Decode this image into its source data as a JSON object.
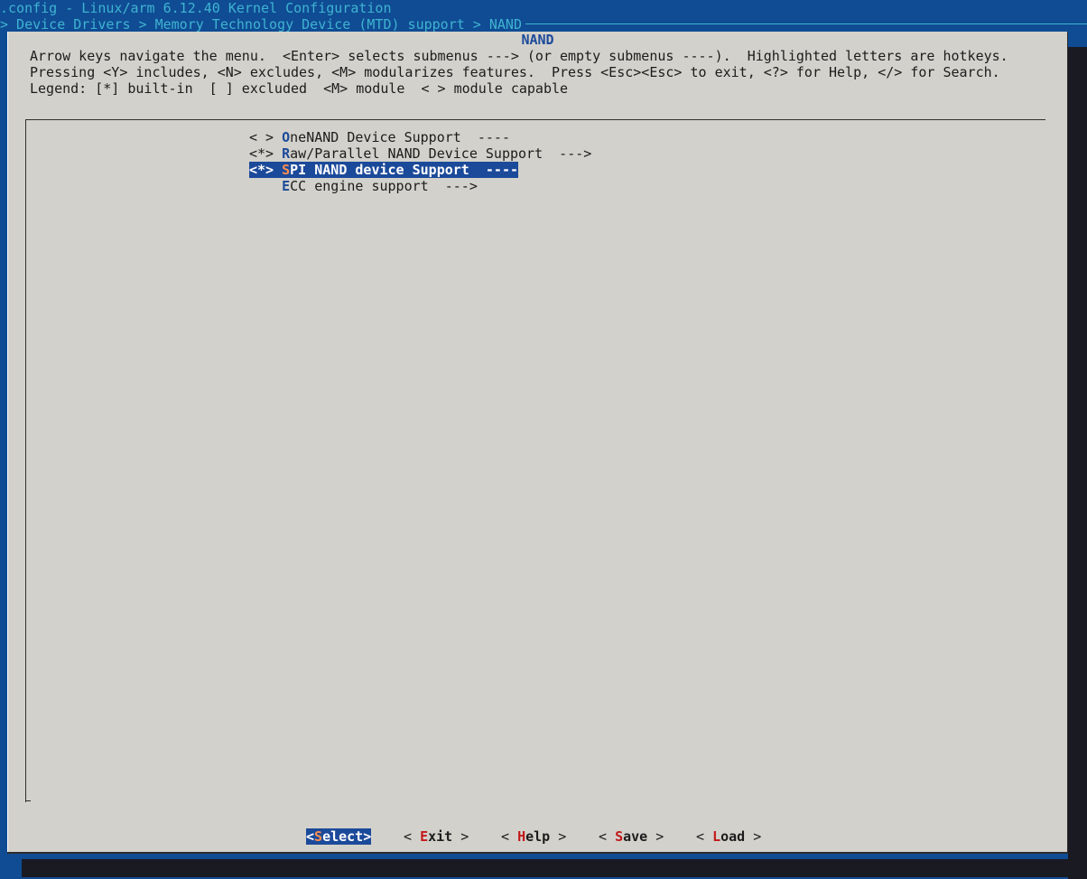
{
  "screen": {
    "title": ".config - Linux/arm 6.12.40 Kernel Configuration",
    "breadcrumb": "> Device Drivers > Memory Technology Device (MTD) support > NAND"
  },
  "dialog": {
    "title": "NAND",
    "help_lines": [
      "Arrow keys navigate the menu.  <Enter> selects submenus ---> (or empty submenus ----).  Highlighted letters are hotkeys.",
      "Pressing <Y> includes, <N> excludes, <M> modularizes features.  Press <Esc><Esc> to exit, <?> for Help, </> for Search.",
      "Legend: [*] built-in  [ ] excluded  <M> module  < > module capable"
    ]
  },
  "menu": {
    "items": [
      {
        "state": "< > ",
        "hotkey": "O",
        "rest": "neNAND Device Support  ----",
        "selected": false
      },
      {
        "state": "<*> ",
        "hotkey": "R",
        "rest": "aw/Parallel NAND Device Support  --->",
        "selected": false
      },
      {
        "state": "<*> ",
        "hotkey": "S",
        "rest": "PI NAND device Support  ----",
        "selected": true
      },
      {
        "state": "    ",
        "hotkey": "E",
        "rest": "CC engine support  --->",
        "selected": false
      }
    ]
  },
  "buttons": {
    "select": {
      "open": "<",
      "hotkey": "S",
      "rest": "elect",
      "close": ">"
    },
    "exit": {
      "open": "< ",
      "hotkey": "E",
      "rest": "xit",
      "close": " >"
    },
    "help": {
      "open": "< ",
      "hotkey": "H",
      "rest": "elp",
      "close": " >"
    },
    "save": {
      "open": "< ",
      "hotkey": "S",
      "rest": "ave",
      "close": " >"
    },
    "load": {
      "open": "< ",
      "hotkey": "L",
      "rest": "oad",
      "close": " >"
    }
  },
  "colors": {
    "terminal_bg": "#0f4c94",
    "dialog_bg": "#d3d1cb",
    "accent": "#1c4a9a",
    "title_text": "#3fb3d1",
    "button_hotkey": "#c21818",
    "selected_hotkey": "#ff8f4f"
  }
}
